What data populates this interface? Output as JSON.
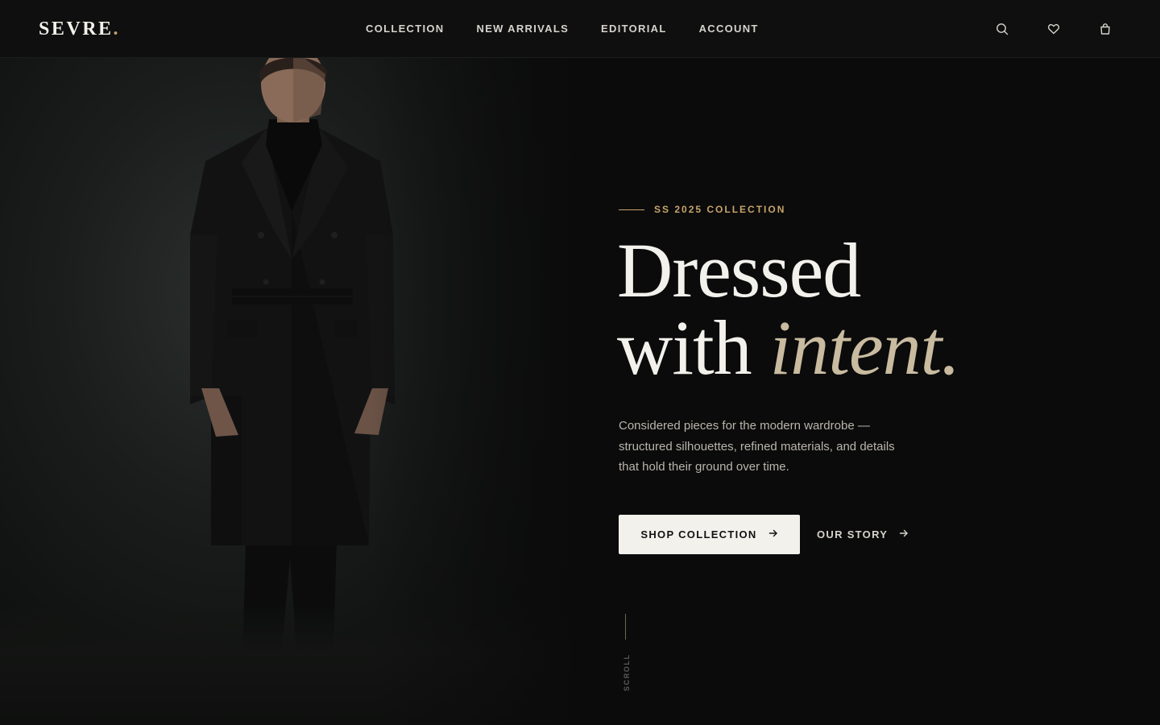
{
  "brand": {
    "name": "SEVRE",
    "dot": "."
  },
  "nav": {
    "links": [
      {
        "label": "COLLECTION"
      },
      {
        "label": "NEW ARRIVALS"
      },
      {
        "label": "EDITORIAL"
      },
      {
        "label": "ACCOUNT"
      }
    ],
    "icons": [
      "search-icon",
      "heart-icon",
      "bag-icon"
    ]
  },
  "hero": {
    "eyebrow": "SS 2025 COLLECTION",
    "headline_line1": "Dressed",
    "headline_line2": "with",
    "headline_accent": "intent.",
    "subtext": "Considered pieces for the modern wardrobe — structured silhouettes, refined materials, and details that hold their ground over time.",
    "primary_cta": "SHOP COLLECTION",
    "secondary_cta": "OUR STORY",
    "scroll_label": "SCROLL"
  },
  "colors": {
    "background": "#0b0b0b",
    "accent_gold": "#c7a46a",
    "accent_beige": "#c9bba0",
    "text_light": "#f3f1ec"
  }
}
